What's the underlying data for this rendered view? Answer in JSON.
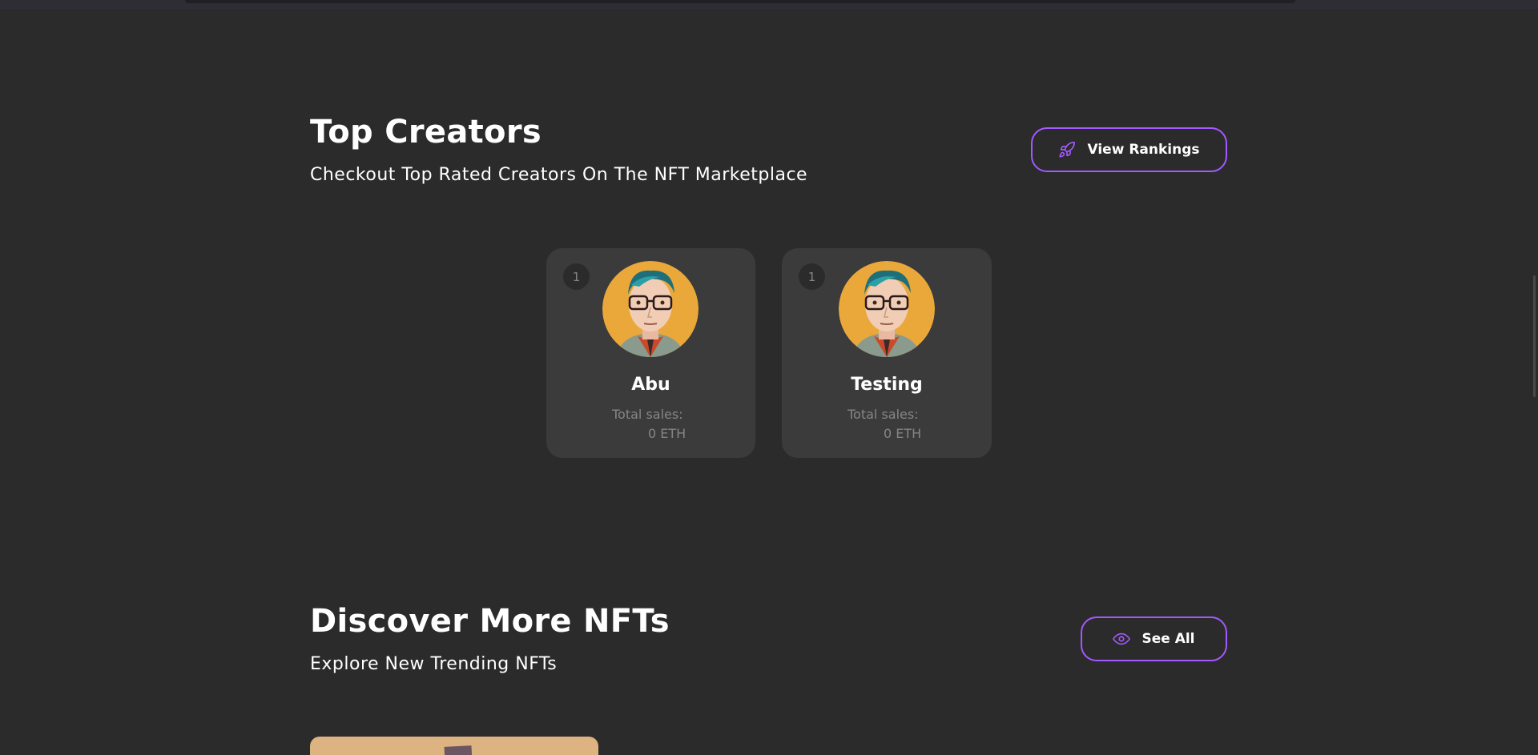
{
  "top_creators": {
    "title": "Top Creators",
    "subtitle": "Checkout Top Rated Creators On The NFT Marketplace",
    "view_rankings_label": "View Rankings",
    "sales_label": "Total sales:",
    "creators": [
      {
        "rank": "1",
        "name": "Abu",
        "total_sales": "0 ETH"
      },
      {
        "rank": "1",
        "name": "Testing",
        "total_sales": "0 ETH"
      }
    ]
  },
  "discover": {
    "title": "Discover More NFTs",
    "subtitle": "Explore New Trending NFTs",
    "see_all_label": "See All"
  },
  "icons": {
    "view_rankings": "rocket-icon",
    "see_all": "eye-icon"
  },
  "colors": {
    "background": "#2b2b2b",
    "card": "#3b3b3b",
    "accent": "#a259ff",
    "muted_text": "#858584"
  }
}
